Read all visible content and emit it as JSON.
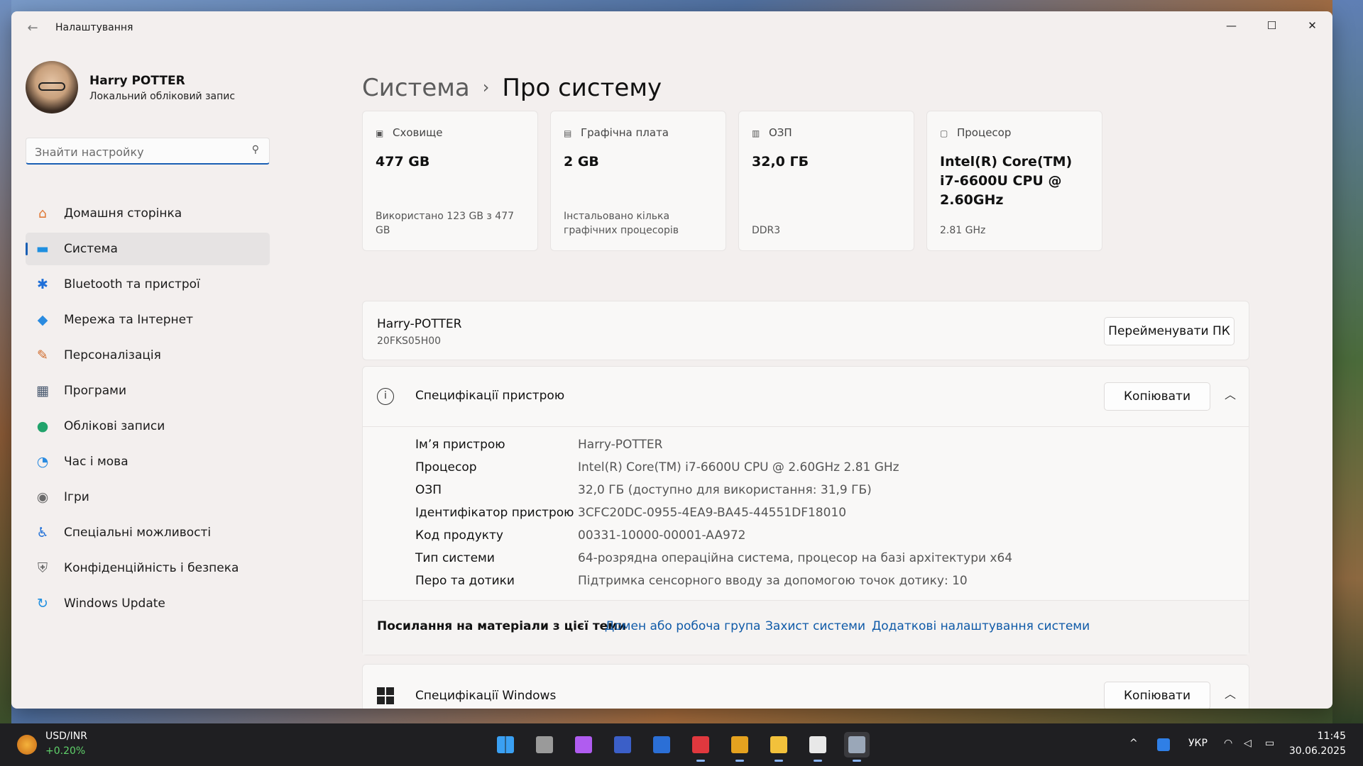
{
  "window": {
    "title": "Налаштування",
    "controls": {
      "minimize": "—",
      "maximize": "☐",
      "close": "✕"
    }
  },
  "user": {
    "name": "Harry POTTER",
    "account_type": "Локальний обліковий запис"
  },
  "search": {
    "placeholder": "Знайти настройку"
  },
  "sidebar": {
    "items": [
      {
        "label": "Домашня сторінка",
        "icon": "home-icon",
        "glyph": "⌂",
        "color": "#e07b39"
      },
      {
        "label": "Система",
        "icon": "system-icon",
        "glyph": "▬",
        "color": "#1f8fe0",
        "active": true
      },
      {
        "label": "Bluetooth та пристрої",
        "icon": "bluetooth-icon",
        "glyph": "✱",
        "color": "#1f6fd8"
      },
      {
        "label": "Мережа та Інтернет",
        "icon": "wifi-icon",
        "glyph": "◆",
        "color": "#2a8be0"
      },
      {
        "label": "Персоналізація",
        "icon": "brush-icon",
        "glyph": "✎",
        "color": "#d06b2b"
      },
      {
        "label": "Програми",
        "icon": "apps-icon",
        "glyph": "▦",
        "color": "#4a5a70"
      },
      {
        "label": "Облікові записи",
        "icon": "account-icon",
        "glyph": "●",
        "color": "#21a36b"
      },
      {
        "label": "Час і мова",
        "icon": "clock-globe-icon",
        "glyph": "◔",
        "color": "#2a8be0"
      },
      {
        "label": "Ігри",
        "icon": "gamepad-icon",
        "glyph": "◉",
        "color": "#6a6a6a"
      },
      {
        "label": "Спеціальні можливості",
        "icon": "accessibility-icon",
        "glyph": "♿",
        "color": "#1f6fd8"
      },
      {
        "label": "Конфіденційність і безпека",
        "icon": "shield-icon",
        "glyph": "⛨",
        "color": "#6a6a6a"
      },
      {
        "label": "Windows Update",
        "icon": "update-icon",
        "glyph": "↻",
        "color": "#1f8fe0"
      }
    ]
  },
  "breadcrumb": {
    "parent": "Система",
    "separator": "›",
    "current": "Про систему"
  },
  "cards": [
    {
      "title": "Сховище",
      "icon": "storage-icon",
      "value": "477 GB",
      "detail": "Використано 123 GB з 477 GB"
    },
    {
      "title": "Графічна плата",
      "icon": "gpu-icon",
      "value": "2 GB",
      "detail": "Інстальовано кілька графічних процесорів"
    },
    {
      "title": "ОЗП",
      "icon": "ram-icon",
      "value": "32,0 ГБ",
      "detail": "DDR3"
    },
    {
      "title": "Процесор",
      "icon": "cpu-icon",
      "value": "Intel(R) Core(TM) i7-6600U CPU @ 2.60GHz",
      "detail": "2.81 GHz"
    }
  ],
  "pc": {
    "name": "Harry-POTTER",
    "model": "20FKS05H00",
    "rename_label": "Перейменувати ПК"
  },
  "device_specs": {
    "title": "Специфікації пристрою",
    "copy_label": "Копіювати",
    "rows": [
      {
        "key": "Ім’я пристрою",
        "value": "Harry-POTTER"
      },
      {
        "key": "Процесор",
        "value": "Intel(R) Core(TM) i7-6600U CPU @ 2.60GHz   2.81 GHz"
      },
      {
        "key": "ОЗП",
        "value": "32,0 ГБ (доступно для використання: 31,9 ГБ)"
      },
      {
        "key": "Ідентифікатор пристрою",
        "value": "3CFC20DC-0955-4EA9-BA45-44551DF18010"
      },
      {
        "key": "Код продукту",
        "value": "00331-10000-00001-AA972"
      },
      {
        "key": "Тип системи",
        "value": "64-розрядна операційна система, процесор на базі архітектури x64"
      },
      {
        "key": "Перо та дотики",
        "value": "Підтримка сенсорного вводу за допомогою точок дотику: 10"
      }
    ]
  },
  "related_links": {
    "label": "Посилання на матеріали з цієї теми",
    "links": [
      "Домен або робоча група",
      "Захист системи",
      "Додаткові налаштування системи"
    ]
  },
  "windows_specs": {
    "title": "Специфікації Windows",
    "copy_label": "Копіювати"
  },
  "taskbar": {
    "widget": {
      "title": "USD/INR",
      "change": "+0.20%"
    },
    "apps": [
      {
        "name": "start-icon",
        "color": "#3aa0f3"
      },
      {
        "name": "task-view-icon",
        "color": "#9a9a9a"
      },
      {
        "name": "copilot-icon",
        "color": "#b05cf0"
      },
      {
        "name": "floppy-app-icon",
        "color": "#3b5fc8"
      },
      {
        "name": "word-icon",
        "color": "#2b6fd6"
      },
      {
        "name": "red-app-icon",
        "color": "#e0383e"
      },
      {
        "name": "chrome-icon",
        "color": "#e5a21f"
      },
      {
        "name": "file-explorer-icon",
        "color": "#f2c13b"
      },
      {
        "name": "store-icon",
        "color": "#e8e8e8"
      },
      {
        "name": "settings-icon",
        "color": "#9aa7b8"
      }
    ],
    "tray": {
      "chevron": "^",
      "language": "УКР",
      "time": "11:45",
      "date": "30.06.2025"
    }
  }
}
